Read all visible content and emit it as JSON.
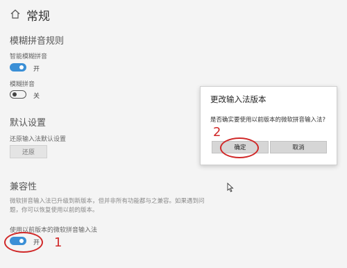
{
  "header": {
    "icon": "home-icon",
    "title": "常规"
  },
  "fuzzy": {
    "section_title": "模糊拼音规则",
    "smart_label": "智能模糊拼音",
    "smart_state": "开",
    "smart_on": true,
    "fuzzy_label": "模糊拼音",
    "fuzzy_state": "关",
    "fuzzy_on": false
  },
  "defaults": {
    "section_title": "默认设置",
    "restore_label": "还原输入法默认设置",
    "restore_button": "还原"
  },
  "compat": {
    "section_title": "兼容性",
    "description": "微软拼音输入法已升级到新版本，但并非所有功能都与之兼容。如果遇到问题，你可以恢复使用以前的版本。",
    "toggle_label": "使用以前版本的微软拼音输入法",
    "toggle_state": "开",
    "toggle_on": true
  },
  "dialog": {
    "title": "更改输入法版本",
    "message": "是否确实要使用以前版本的微软拼音输入法?",
    "ok_label": "确定",
    "cancel_label": "取消"
  },
  "annotations": {
    "step1": "1",
    "step2": "2",
    "color": "#d02828"
  }
}
